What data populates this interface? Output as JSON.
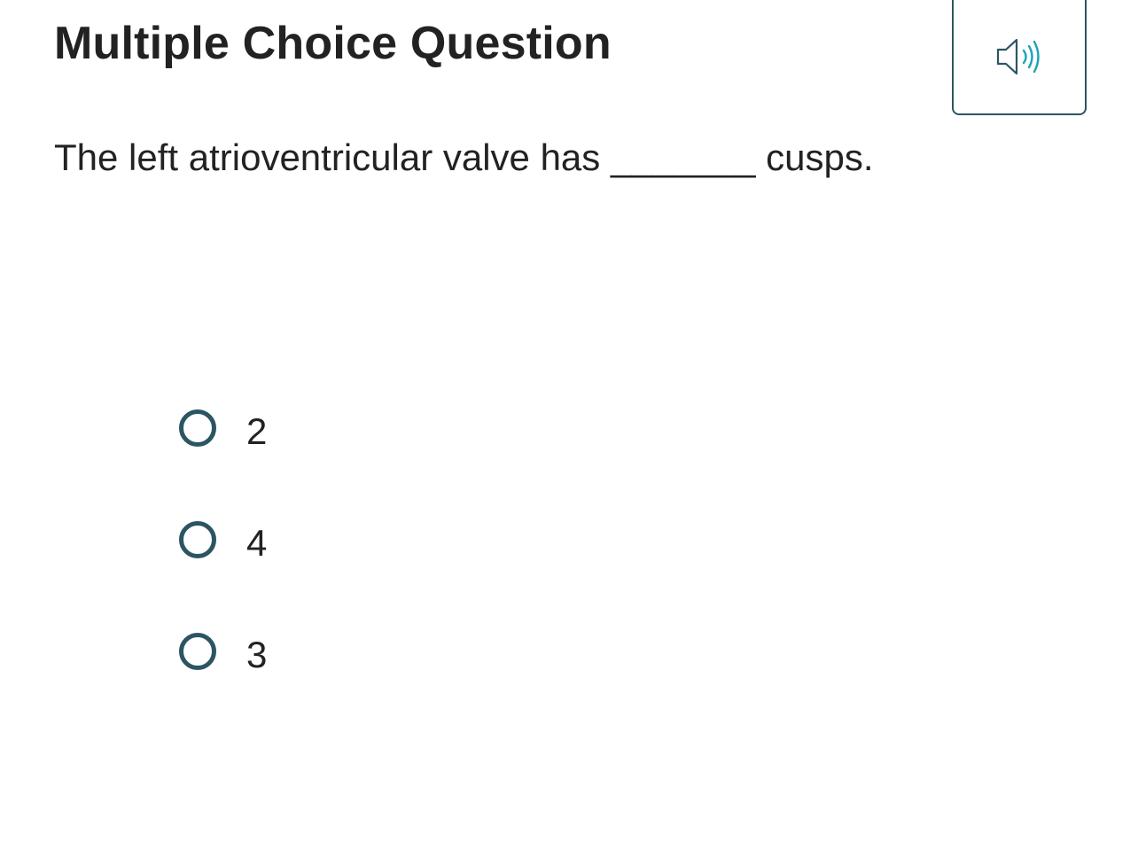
{
  "header": {
    "title": "Multiple Choice Question",
    "audio_icon": "speaker-audio-icon"
  },
  "question": {
    "text": "The left atrioventricular valve has _______ cusps."
  },
  "options": [
    {
      "label": "2",
      "selected": false
    },
    {
      "label": "4",
      "selected": false
    },
    {
      "label": "3",
      "selected": false
    }
  ],
  "colors": {
    "accent": "#2c5563",
    "sound_waves": "#1aa3b5",
    "text": "#222222"
  }
}
